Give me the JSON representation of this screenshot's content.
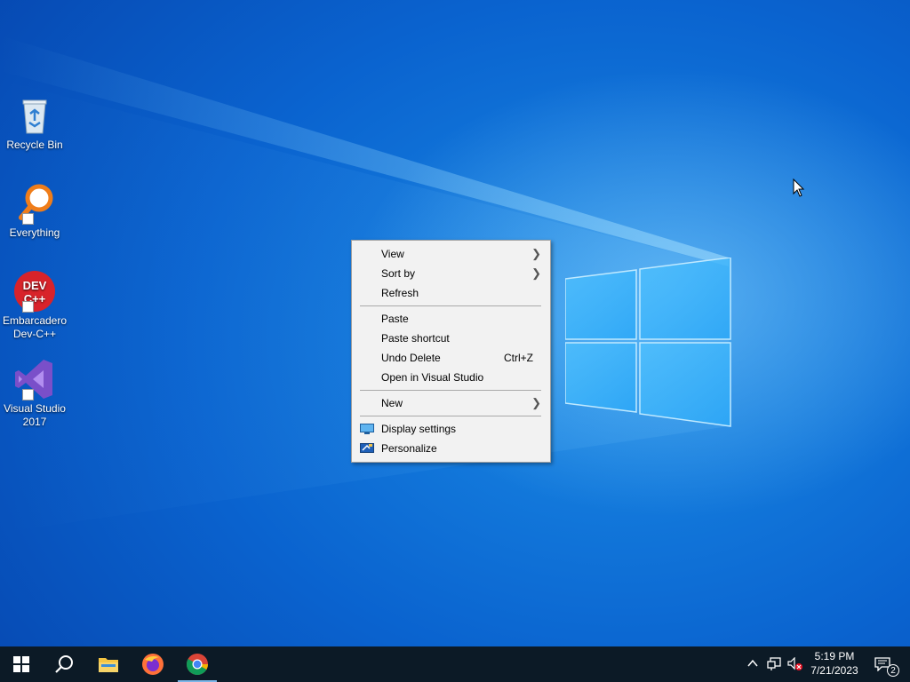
{
  "desktop": {
    "icons": [
      {
        "label": "Recycle Bin",
        "icon": "recycle-bin-icon"
      },
      {
        "label": "Everything",
        "icon": "everything-search-icon"
      },
      {
        "label": "Embarcadero Dev-C++",
        "icon": "dev-cpp-icon"
      },
      {
        "label": "Visual Studio 2017",
        "icon": "visual-studio-icon"
      }
    ]
  },
  "context_menu": {
    "items": [
      {
        "label": "View",
        "submenu": true
      },
      {
        "label": "Sort by",
        "submenu": true
      },
      {
        "label": "Refresh"
      },
      {
        "label": "Paste"
      },
      {
        "label": "Paste shortcut"
      },
      {
        "label": "Undo Delete",
        "shortcut": "Ctrl+Z"
      },
      {
        "label": "Open in Visual Studio"
      },
      {
        "label": "New",
        "submenu": true
      },
      {
        "label": "Display settings",
        "icon": "display-settings-icon"
      },
      {
        "label": "Personalize",
        "icon": "personalize-icon"
      }
    ]
  },
  "taskbar": {
    "apps": [
      {
        "name": "start",
        "icon": "windows-start-icon"
      },
      {
        "name": "search",
        "icon": "search-icon"
      },
      {
        "name": "file-explorer",
        "icon": "folder-icon"
      },
      {
        "name": "firefox",
        "icon": "firefox-icon"
      },
      {
        "name": "chrome",
        "icon": "chrome-icon",
        "active": true
      }
    ],
    "tray": {
      "icons": [
        "chevron-up-icon",
        "network-icon",
        "volume-muted-icon"
      ],
      "time": "5:19 PM",
      "date": "7/21/2023",
      "notification_count": "2"
    }
  },
  "colors": {
    "desktop_accent": "#0a63cf",
    "taskbar_bg": "#0c1a26",
    "menu_bg": "#f2f2f2"
  }
}
